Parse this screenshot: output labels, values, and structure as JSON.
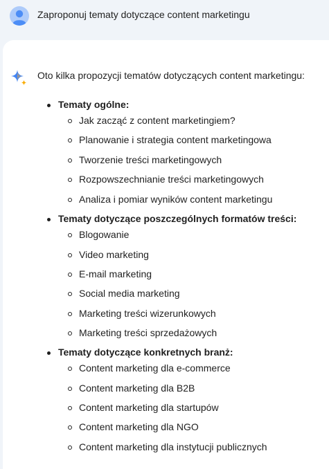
{
  "prompt": {
    "text": "Zaproponuj tematy dotyczące content marketingu"
  },
  "response": {
    "intro": "Oto kilka propozycji tematów dotyczących content marketingu:",
    "sections": [
      {
        "title": "Tematy ogólne:",
        "items": [
          "Jak zacząć z content marketingiem?",
          "Planowanie i strategia content marketingowa",
          "Tworzenie treści marketingowych",
          "Rozpowszechnianie treści marketingowych",
          "Analiza i pomiar wyników content marketingu"
        ]
      },
      {
        "title": "Tematy dotyczące poszczególnych formatów treści:",
        "items": [
          "Blogowanie",
          "Video marketing",
          "E-mail marketing",
          "Social media marketing",
          "Marketing treści wizerunkowych",
          "Marketing treści sprzedażowych"
        ]
      },
      {
        "title": "Tematy dotyczące konkretnych branż:",
        "items": [
          "Content marketing dla e-commerce",
          "Content marketing dla B2B",
          "Content marketing dla startupów",
          "Content marketing dla NGO",
          "Content marketing dla instytucji publicznych"
        ]
      }
    ]
  },
  "icons": {
    "avatar": "user-avatar-icon",
    "assistant": "sparkle-icon"
  },
  "colors": {
    "page_bg": "#f0f4f9",
    "card_bg": "#ffffff",
    "avatar_bg": "#aecbfa",
    "avatar_fg": "#4c8df6",
    "spark_blue": "#4285f4",
    "spark_yellow": "#f9ab00"
  }
}
